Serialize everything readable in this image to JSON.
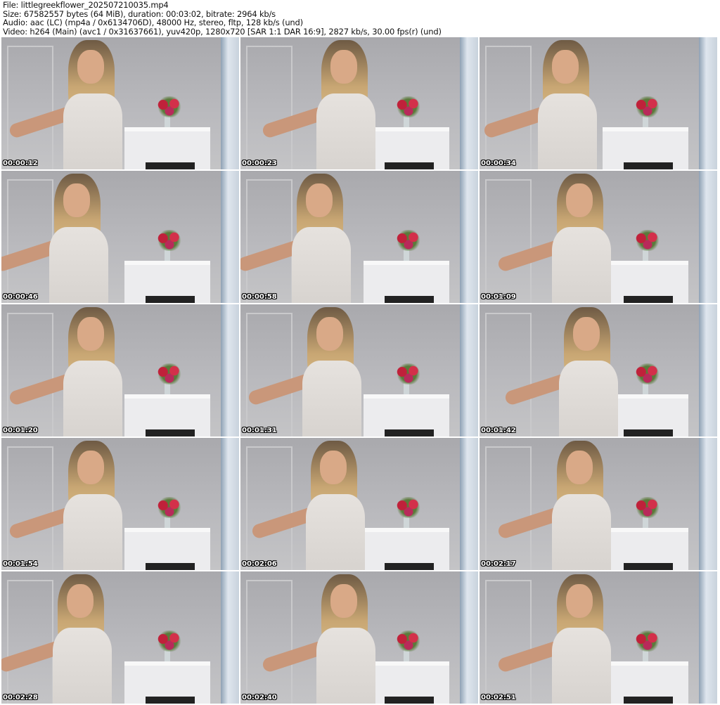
{
  "header": {
    "file": "File: littlegreekflower_202507210035.mp4",
    "size": "Size: 67582557 bytes (64 MiB), duration: 00:03:02, bitrate: 2964 kb/s",
    "audio": "Audio: aac (LC) (mp4a / 0x6134706D), 48000 Hz, stereo, fltp, 128 kb/s (und)",
    "video": "Video: h264 (Main) (avc1 / 0x31637661), yuv420p, 1280x720 [SAR 1:1 DAR 16:9], 2827 kb/s, 30.00 fps(r) (und)"
  },
  "thumbnails": [
    {
      "timestamp": "00:00:12"
    },
    {
      "timestamp": "00:00:23"
    },
    {
      "timestamp": "00:00:34"
    },
    {
      "timestamp": "00:00:46"
    },
    {
      "timestamp": "00:00:58"
    },
    {
      "timestamp": "00:01:09"
    },
    {
      "timestamp": "00:01:20"
    },
    {
      "timestamp": "00:01:31"
    },
    {
      "timestamp": "00:01:42"
    },
    {
      "timestamp": "00:01:54"
    },
    {
      "timestamp": "00:02:06"
    },
    {
      "timestamp": "00:02:17"
    },
    {
      "timestamp": "00:02:28"
    },
    {
      "timestamp": "00:02:40"
    },
    {
      "timestamp": "00:02:51"
    }
  ]
}
